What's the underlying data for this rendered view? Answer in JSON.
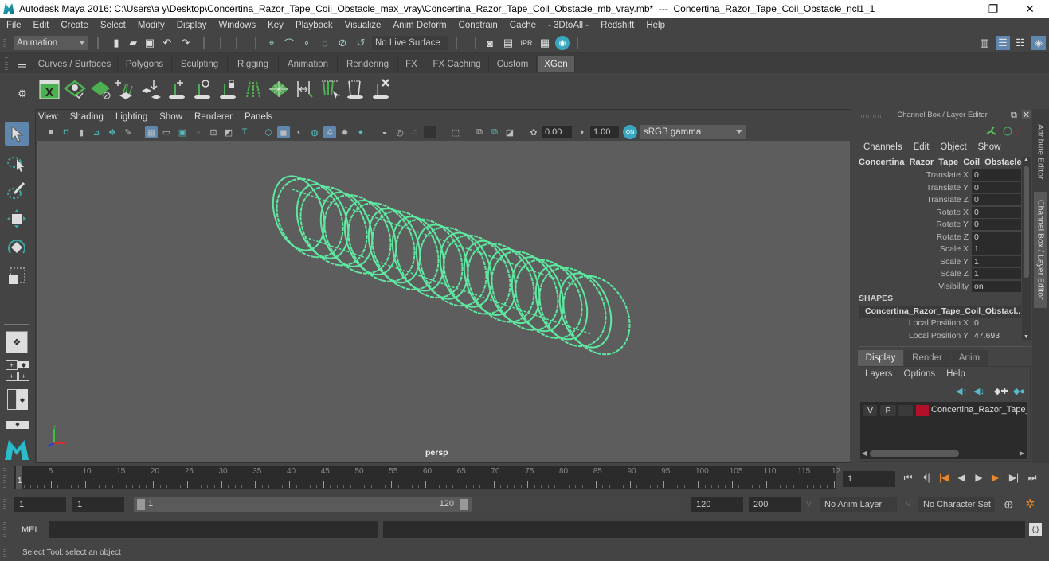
{
  "window": {
    "title": "Autodesk Maya 2016: C:\\Users\\a y\\Desktop\\Concertina_Razor_Tape_Coil_Obstacle_max_vray\\Concertina_Razor_Tape_Coil_Obstacle_mb_vray.mb*  ---  Concertina_Razor_Tape_Coil_Obstacle_ncl1_1",
    "minimize": "—",
    "maximize": "❐",
    "close": "✕"
  },
  "menubar": [
    "File",
    "Edit",
    "Create",
    "Select",
    "Modify",
    "Display",
    "Windows",
    "Key",
    "Playback",
    "Visualize",
    "Anim Deform",
    "Constrain",
    "Cache",
    "- 3DtoAll -",
    "Redshift",
    "Help"
  ],
  "statusline": {
    "menuset": "Animation",
    "live_surface": "No Live Surface"
  },
  "shelf_tabs": [
    {
      "label": "Curves / Surfaces",
      "active": false
    },
    {
      "label": "Polygons",
      "active": false
    },
    {
      "label": "Sculpting",
      "active": false
    },
    {
      "label": "Rigging",
      "active": false
    },
    {
      "label": "Animation",
      "active": false
    },
    {
      "label": "Rendering",
      "active": false
    },
    {
      "label": "FX",
      "active": false
    },
    {
      "label": "FX Caching",
      "active": false
    },
    {
      "label": "Custom",
      "active": false
    },
    {
      "label": "XGen",
      "active": true
    }
  ],
  "viewport": {
    "menu": [
      "View",
      "Shading",
      "Lighting",
      "Show",
      "Renderer",
      "Panels"
    ],
    "exposure": "0.00",
    "gamma": "1.00",
    "color_space": "sRGB gamma",
    "camera_label": "persp",
    "wire_color": "#5ee8a0"
  },
  "channel_box": {
    "title": "Channel Box / Layer Editor",
    "menu": [
      "Channels",
      "Edit",
      "Object",
      "Show"
    ],
    "object_name": "Concertina_Razor_Tape_Coil_Obstacle_...",
    "channels": [
      {
        "label": "Translate X",
        "value": "0"
      },
      {
        "label": "Translate Y",
        "value": "0"
      },
      {
        "label": "Translate Z",
        "value": "0"
      },
      {
        "label": "Rotate X",
        "value": "0"
      },
      {
        "label": "Rotate Y",
        "value": "0"
      },
      {
        "label": "Rotate Z",
        "value": "0"
      },
      {
        "label": "Scale X",
        "value": "1"
      },
      {
        "label": "Scale Y",
        "value": "1"
      },
      {
        "label": "Scale Z",
        "value": "1"
      },
      {
        "label": "Visibility",
        "value": "on"
      }
    ],
    "shapes_header": "SHAPES",
    "shape_name": "Concertina_Razor_Tape_Coil_Obstacl...",
    "shape_channels": [
      {
        "label": "Local Position X",
        "value": "0"
      },
      {
        "label": "Local Position Y",
        "value": "47.693"
      }
    ]
  },
  "side_tabs": [
    "Attribute Editor",
    "Channel Box / Layer Editor"
  ],
  "layer_editor": {
    "tabs": [
      {
        "label": "Display",
        "active": true
      },
      {
        "label": "Render",
        "active": false
      },
      {
        "label": "Anim",
        "active": false
      }
    ],
    "menu": [
      "Layers",
      "Options",
      "Help"
    ],
    "layers": [
      {
        "v": "V",
        "p": "P",
        "color": "#b0102a",
        "name": "Concertina_Razor_Tape_"
      }
    ]
  },
  "timeline": {
    "ticks": [
      "5",
      "10",
      "15",
      "20",
      "25",
      "30",
      "35",
      "40",
      "45",
      "50",
      "55",
      "60",
      "65",
      "70",
      "75",
      "80",
      "85",
      "90",
      "95",
      "100",
      "105",
      "110",
      "115",
      "12"
    ],
    "current_frame_marker": "1",
    "current_frame": "1"
  },
  "range": {
    "start": "1",
    "playback_start": "1",
    "slider_start": "1",
    "slider_end": "120",
    "playback_end": "120",
    "end": "200",
    "anim_layer": "No Anim Layer",
    "character_set": "No Character Set"
  },
  "command": {
    "mel_label": "MEL",
    "help_text": "Select Tool: select an object"
  }
}
